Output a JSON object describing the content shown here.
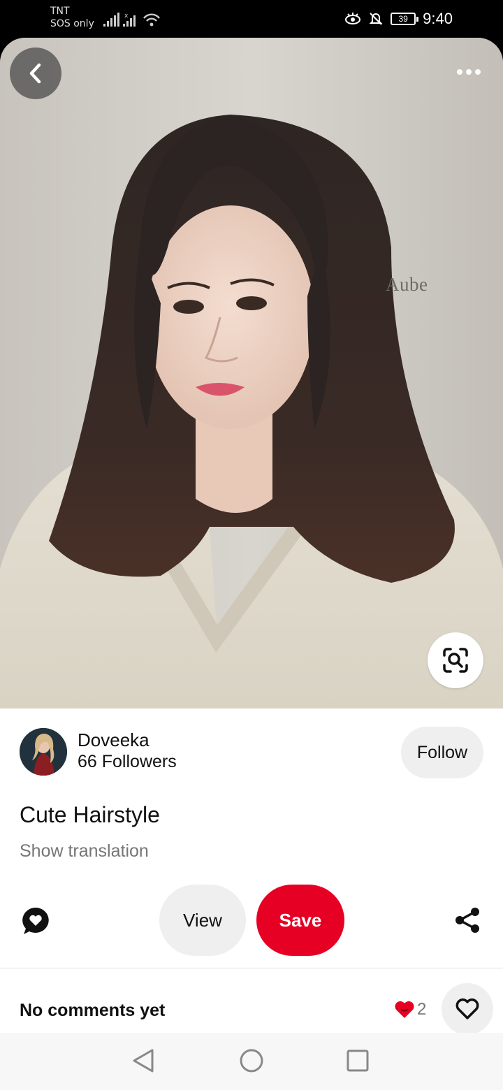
{
  "status_bar": {
    "carrier": "TNT",
    "carrier_sub": "SOS only",
    "battery": "39",
    "time": "9:40"
  },
  "pin": {
    "watermark": "Aube"
  },
  "creator": {
    "name": "Doveeka",
    "followers": "66 Followers",
    "follow_label": "Follow"
  },
  "title": "Cute Hairstyle",
  "show_translation": "Show translation",
  "actions": {
    "view_label": "View",
    "save_label": "Save"
  },
  "comments": {
    "label": "No comments yet",
    "reaction_count": "2"
  },
  "colors": {
    "save_red": "#e60023",
    "reaction_heart": "#e60023"
  }
}
